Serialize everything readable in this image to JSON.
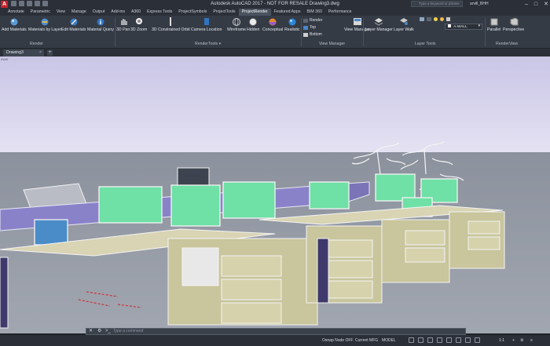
{
  "window": {
    "app_icon_letter": "A",
    "title": "Autodesk AutoCAD 2017 - NOT FOR RESALE   Drawing3.dwg",
    "search_placeholder": "Type a keyword or phrase",
    "user": "arvill_BHH",
    "controls": [
      "–",
      "□",
      "✕"
    ]
  },
  "ribbon_tabs": [
    {
      "label": "Annotate"
    },
    {
      "label": "Parametric"
    },
    {
      "label": "View"
    },
    {
      "label": "Manage"
    },
    {
      "label": "Output"
    },
    {
      "label": "Add-ins"
    },
    {
      "label": "A360"
    },
    {
      "label": "Express Tools"
    },
    {
      "label": "ProjectSymbols"
    },
    {
      "label": "ProjectTools"
    },
    {
      "label": "ProjectRender",
      "active": true
    },
    {
      "label": "Featured Apps"
    },
    {
      "label": "BIM 360"
    },
    {
      "label": "Performance"
    }
  ],
  "ribbon": {
    "render_panel": {
      "label": "Render",
      "buttons": [
        "Add Materials",
        "Materials by Layer",
        "Edit Materials",
        "Material Query"
      ]
    },
    "rendertools_panel": {
      "label": "RenderTools",
      "buttons": [
        "3D Pan",
        "3D Zoom",
        "3D Constrained Orbit",
        "Camera Location",
        "Wireframe",
        "Hidden",
        "Conceptual",
        "Realistic"
      ]
    },
    "view_manager_panel": {
      "label": "View Manager",
      "small_buttons": [
        "Render",
        "Top",
        "Bottom"
      ],
      "big_button": "View Manager"
    },
    "layer_tools_panel": {
      "label": "Layer Tools",
      "buttons": [
        "Layer Manager",
        "Layer Walk"
      ],
      "current_layer": "A-WALL"
    },
    "renderview_panel": {
      "label": "RenderView",
      "buttons": [
        "Parallel",
        "Perspective"
      ]
    }
  },
  "document_tabs": {
    "active": "Drawing3",
    "close": "×",
    "add": "+"
  },
  "viewport": {
    "label": "ewer"
  },
  "command_line": {
    "close": "✕",
    "wrench": "⚙",
    "prompt": ">_",
    "placeholder": "Type a command"
  },
  "status_bar": {
    "osnap": "Osnap Node OFF",
    "layer": "Current MFG",
    "space": "MODEL",
    "scale": "1:1"
  },
  "colors": {
    "sky": "#d9d6ee",
    "floor": "#8b919e",
    "partition": "#8a82c9",
    "screen": "#6fe0a6",
    "cabinet": "#c9c59c",
    "accent_blue": "#4a90d9"
  }
}
